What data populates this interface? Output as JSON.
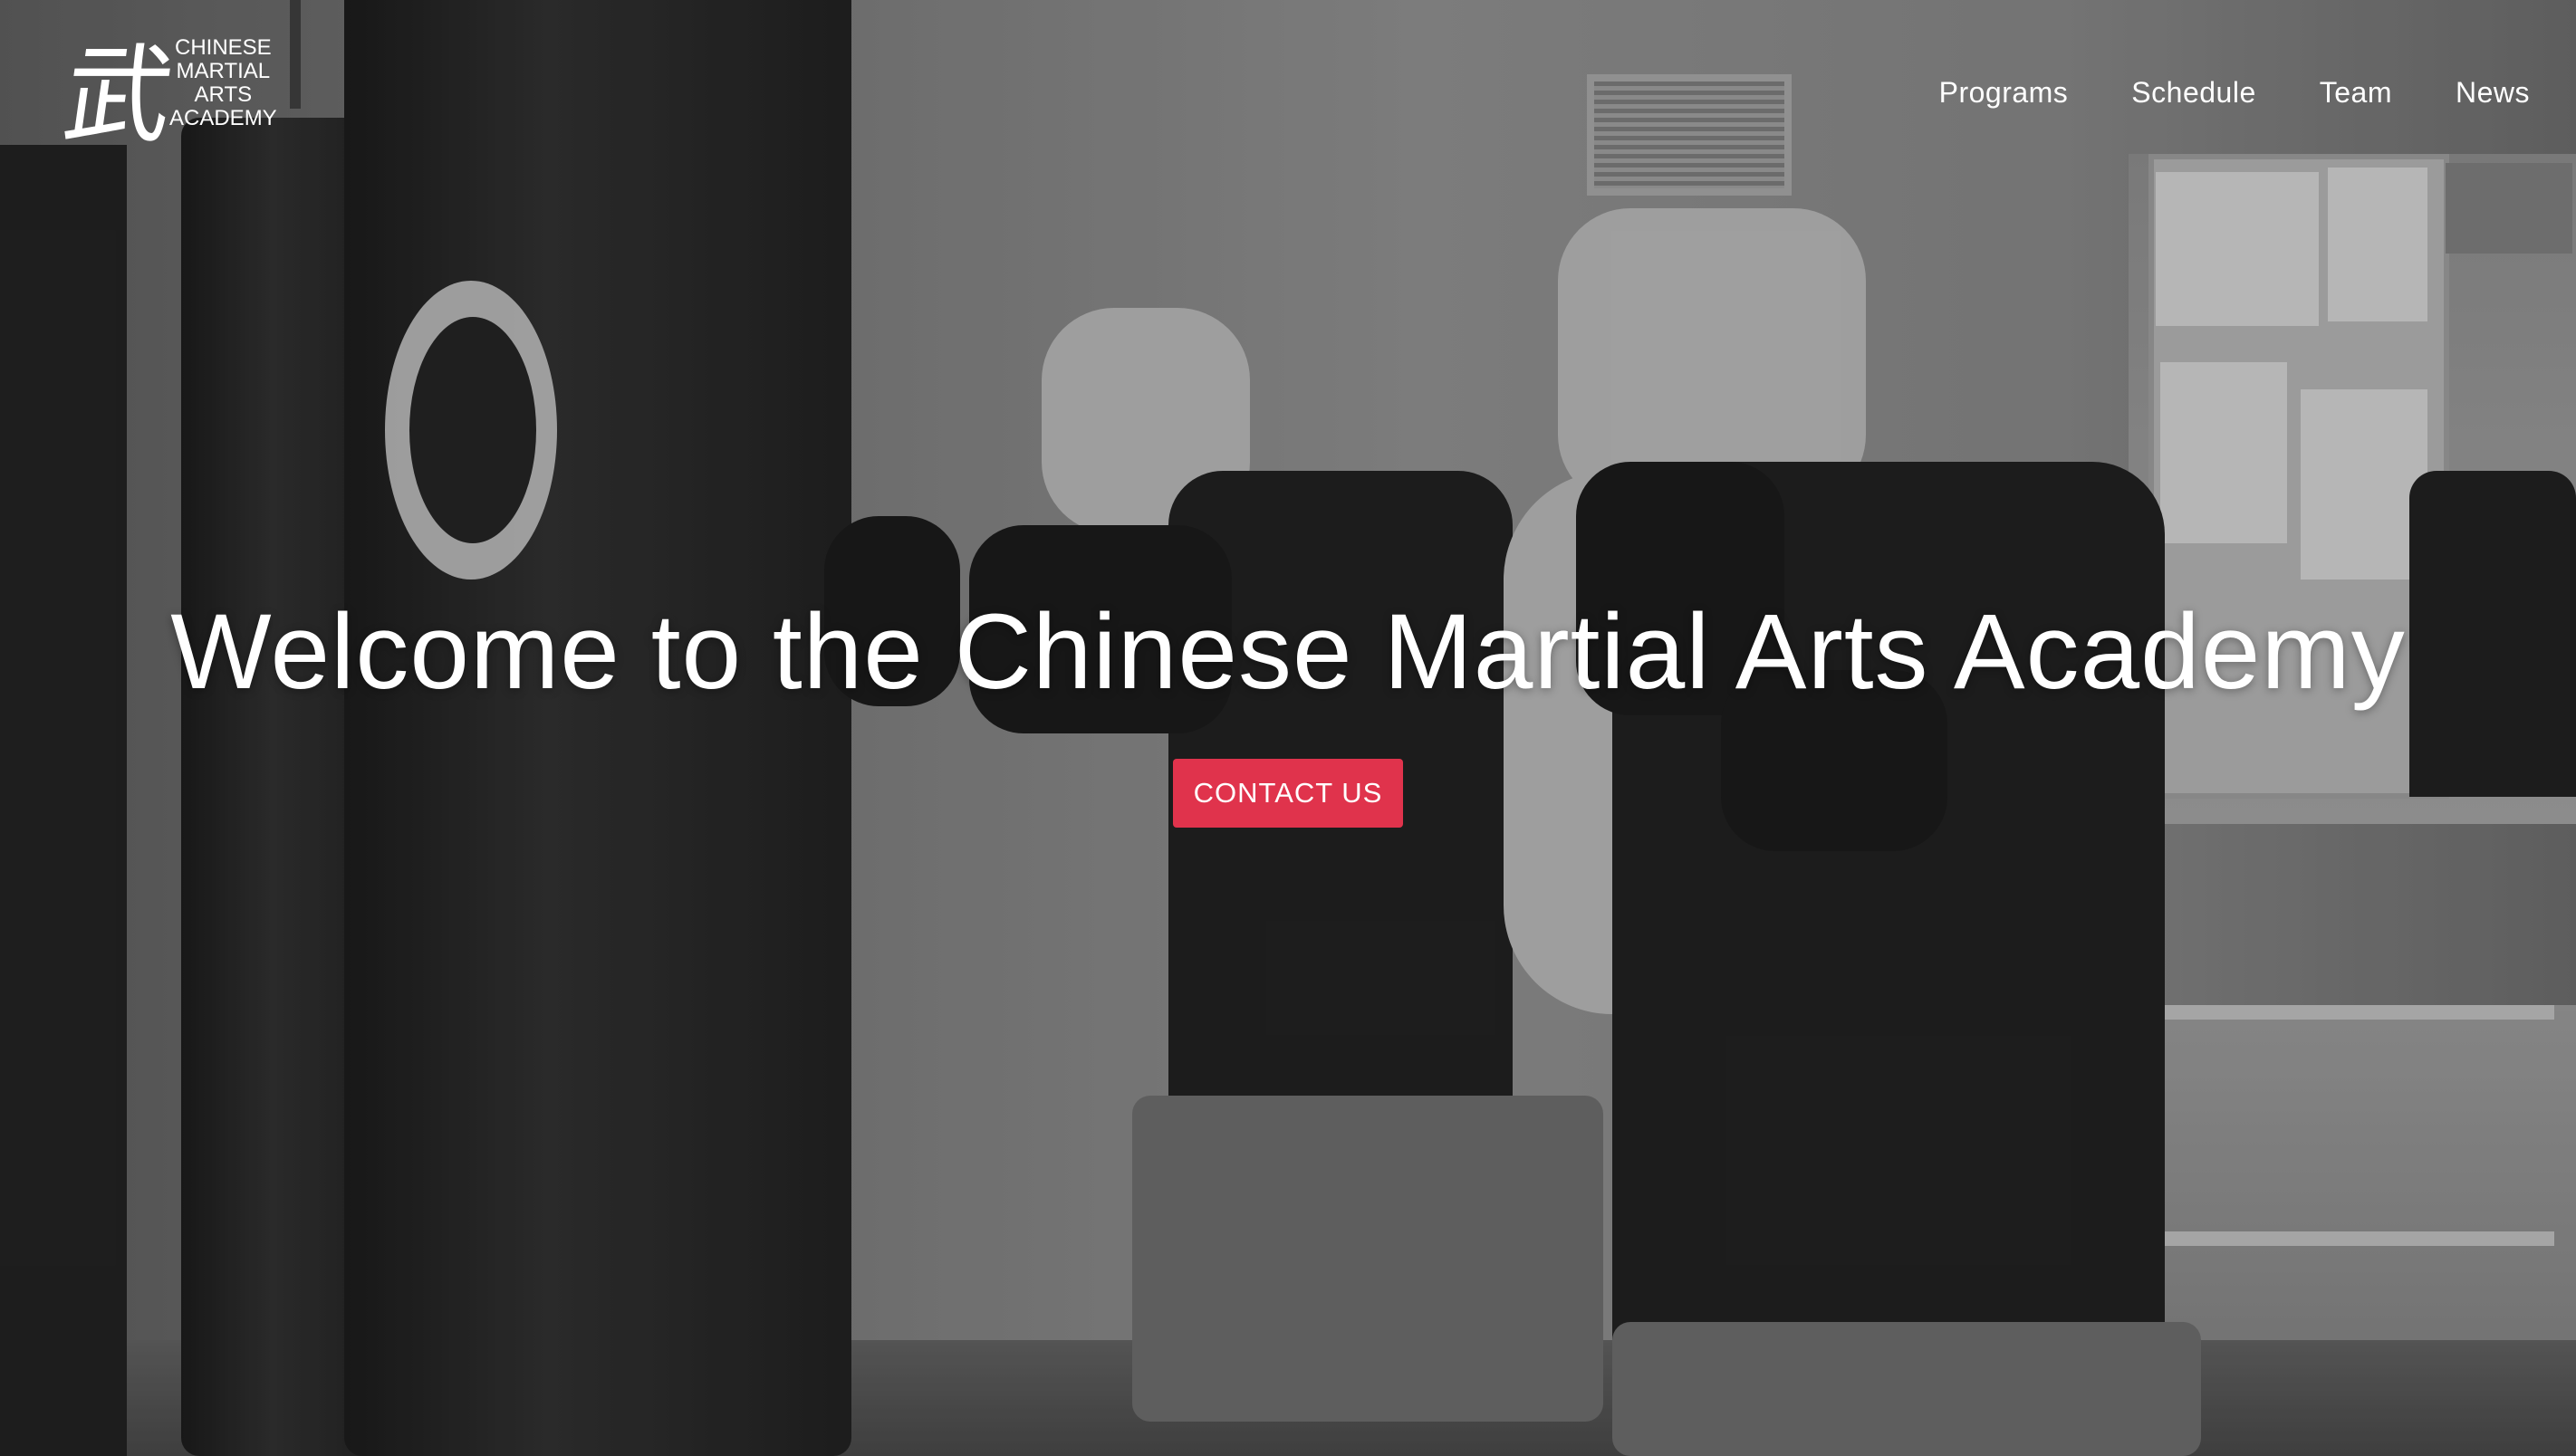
{
  "brand": {
    "logo_glyph": "武",
    "logo_lines": [
      "CHINESE",
      "MARTIAL",
      "ARTS",
      "ACADEMY"
    ]
  },
  "nav": {
    "items": [
      {
        "label": "Programs"
      },
      {
        "label": "Schedule"
      },
      {
        "label": "Team"
      },
      {
        "label": "News"
      }
    ]
  },
  "hero": {
    "title": "Welcome to the Chinese Martial Arts Academy",
    "cta_label": "CONTACT US",
    "cta_color": "#e0334c",
    "background_icon": "boxing-training-photo"
  }
}
